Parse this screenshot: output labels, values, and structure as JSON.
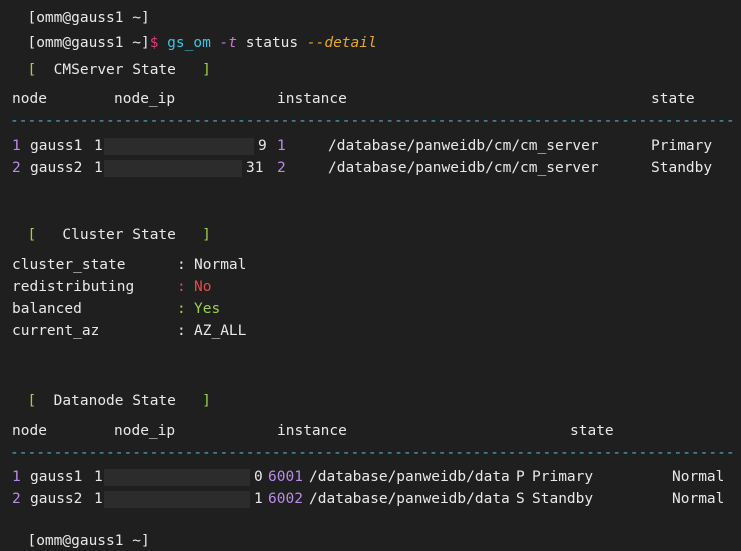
{
  "top_cut_text": "[omm@gauss1 ~]",
  "command": {
    "prompt": "[omm@gauss1 ~]",
    "dollar": "$",
    "program": "gs_om",
    "flag": "-t",
    "arg": "status",
    "option": "--detail"
  },
  "cmserver": {
    "title_open": "[",
    "title": "CMServer State",
    "title_close": "]",
    "headers": {
      "node": "node",
      "node_ip": "node_ip",
      "instance": "instance",
      "state": "state"
    },
    "dashes": "-----------------------------------------------------------------------------------",
    "rows": [
      {
        "idx": "1",
        "node": "gauss1",
        "ip_start": "1",
        "ip_end": "9",
        "inst": "1",
        "path": "/database/panweidb/cm/cm_server",
        "state": "Primary"
      },
      {
        "idx": "2",
        "node": "gauss2",
        "ip_start": "1",
        "ip_end": "31",
        "inst": "2",
        "path": "/database/panweidb/cm/cm_server",
        "state": "Standby"
      }
    ]
  },
  "cluster": {
    "title_open": "[",
    "title": "Cluster State",
    "title_close": "]",
    "items": [
      {
        "key": "cluster_state",
        "sep": ":",
        "value": "Normal"
      },
      {
        "key": "redistributing",
        "sep": ":",
        "value": "No"
      },
      {
        "key": "balanced",
        "sep": ":",
        "value": "Yes"
      },
      {
        "key": "current_az",
        "sep": ":",
        "value": "AZ_ALL"
      }
    ]
  },
  "datanode": {
    "title_open": "[",
    "title": "Datanode State",
    "title_close": "]",
    "headers": {
      "node": "node",
      "node_ip": "node_ip",
      "instance": "instance",
      "state": "state"
    },
    "dashes": "-----------------------------------------------------------------------------------",
    "rows": [
      {
        "idx": "1",
        "node": "gauss1",
        "ip_start": "1",
        "ip_end": "0",
        "inst": "6001",
        "path": "/database/panweidb/data",
        "role": "P",
        "state": "Primary",
        "status": "Normal"
      },
      {
        "idx": "2",
        "node": "gauss2",
        "ip_start": "1",
        "ip_end": "1",
        "inst": "6002",
        "path": "/database/panweidb/data",
        "role": "S",
        "state": "Standby",
        "status": "Normal"
      }
    ]
  },
  "bottom_prompt": "[omm@gauss1 ~]"
}
